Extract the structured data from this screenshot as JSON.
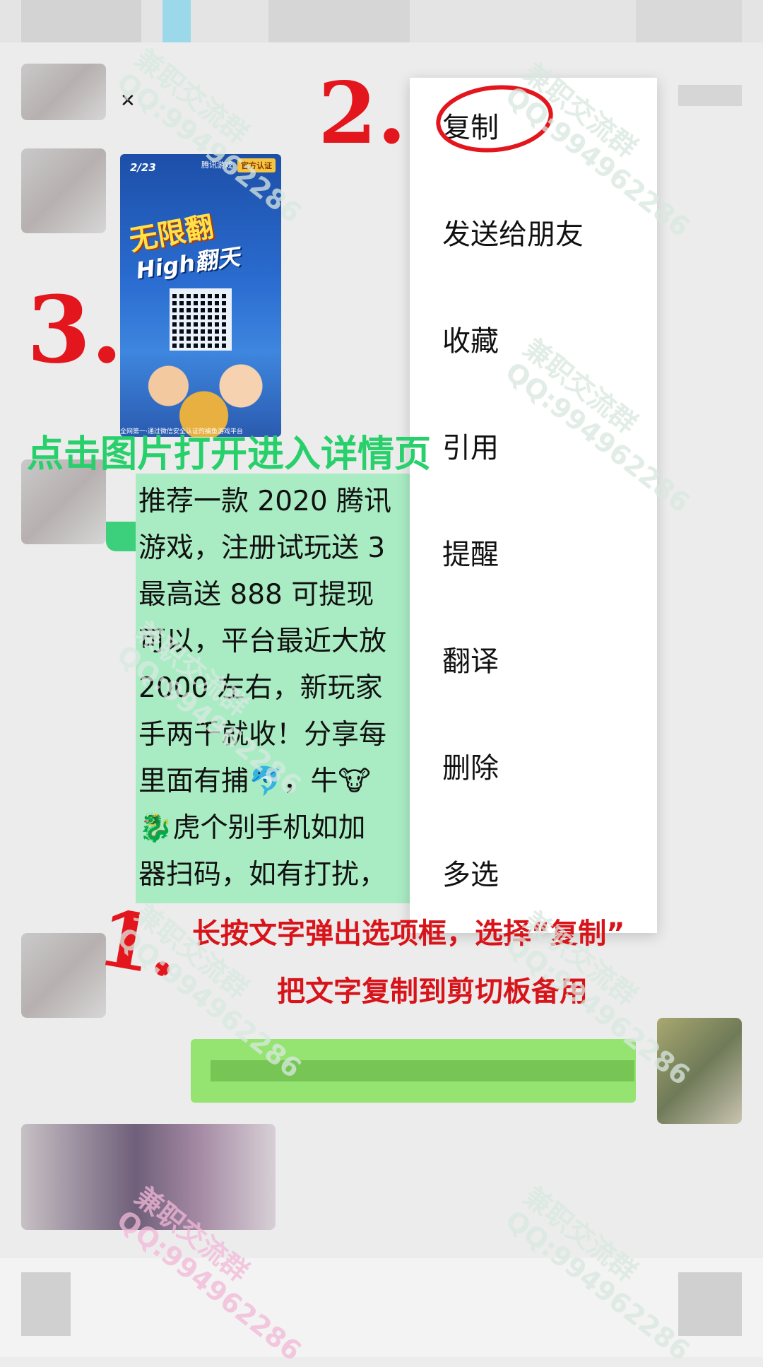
{
  "menu": {
    "items": [
      "复制",
      "发送给朋友",
      "收藏",
      "引用",
      "提醒",
      "翻译",
      "删除",
      "多选"
    ]
  },
  "image_card": {
    "page": "2/23",
    "logo": "腾讯游戏",
    "badge": "官方认证",
    "title_line1": "无限翻",
    "title_line2": "High翻天",
    "caption": "全网第一·通过微信安全认证的捕鱼游戏平台"
  },
  "message": {
    "lines": [
      "推荐一款 2020 腾讯",
      "游戏，注册试玩送 3",
      "最高送 888 可提现",
      "可以，平台最近大放",
      "2000 左右，新玩家",
      "手两千就收！分享每",
      "里面有捕🐬，牛🐮",
      "🐉虎个别手机如加",
      "器扫码，如有打扰，"
    ]
  },
  "annotations": {
    "green_instruction": "点击图片打开进入详情页",
    "red_instruction_1": "长按文字弹出选项框，选择“复制”",
    "red_instruction_2": "把文字复制到剪切板备用",
    "step1": "1.",
    "step2": "2.",
    "step3": "3.",
    "watermark": "兼职交流群\nQQ:994962286"
  },
  "colors": {
    "menu_bg": "#ffffff",
    "bubble_bg": "#a9ecc4",
    "outgoing_bg": "#95e472",
    "green_text": "#27d06a",
    "red_text": "#d8141b"
  }
}
